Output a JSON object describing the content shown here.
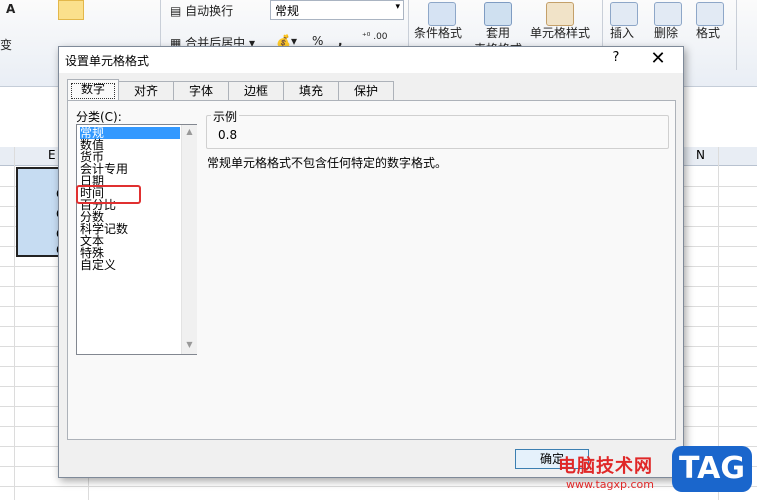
{
  "ribbon": {
    "auto_wrap": "自动换行",
    "merge_center": "合并后居中",
    "number_format": "常规",
    "percent_symbol": "%",
    "comma_symbol": ",",
    "cond_format": "条件格式",
    "table_format_line1": "套用",
    "table_format_line2": "表格格式",
    "cell_styles": "单元格样式",
    "insert": "插入",
    "delete": "删除",
    "format": "格式",
    "left_letter": "A",
    "left_label": "变"
  },
  "sheet": {
    "col_e": "E",
    "col_n": "N",
    "cell_marks": [
      "C",
      "C",
      "C",
      "C"
    ]
  },
  "dialog": {
    "title": "设置单元格格式",
    "help": "?",
    "close": "✕",
    "tabs": [
      "数字",
      "对齐",
      "字体",
      "边框",
      "填充",
      "保护"
    ],
    "active_tab": "数字",
    "category_label": "分类(C):",
    "categories": [
      "常规",
      "数值",
      "货币",
      "会计专用",
      "日期",
      "时间",
      "百分比",
      "分数",
      "科学记数",
      "文本",
      "特殊",
      "自定义"
    ],
    "selected_category": "常规",
    "highlighted_category": "百分比",
    "sample_label": "示例",
    "sample_value": "0.8",
    "description": "常规单元格格式不包含任何特定的数字格式。",
    "ok_label": "确定"
  },
  "watermark": {
    "site_name": "电脑技术网",
    "site_url": "www.tagxp.com",
    "logo_text": "TAG"
  },
  "colors": {
    "selection": "#3399ff",
    "highlight_box": "#e03030",
    "watermark_red": "#e02828",
    "logo_blue": "#1a66cc"
  }
}
